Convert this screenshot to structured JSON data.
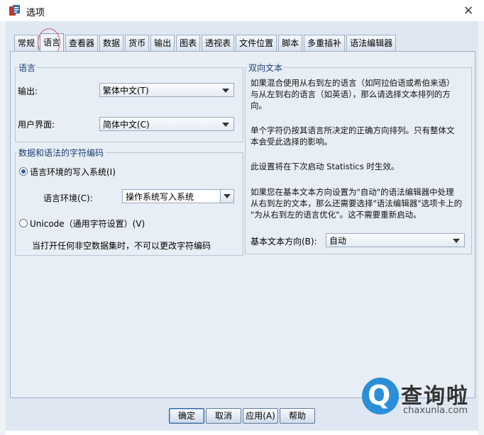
{
  "window": {
    "title": "选项",
    "close_glyph": "×",
    "icon": "spss-app-icon"
  },
  "tabs": [
    "常规",
    "语言",
    "查看器",
    "数据",
    "货币",
    "输出",
    "图表",
    "透视表",
    "文件位置",
    "脚本",
    "多重插补",
    "语法编辑器"
  ],
  "active_tab": "语言",
  "language_group": {
    "legend": "语言",
    "output_label": "输出:",
    "output_value": "繁体中文(T)",
    "ui_label": "用户界面:",
    "ui_value": "简体中文(C)"
  },
  "encoding_group": {
    "legend": "数据和语法的字符编码",
    "locale_radio_label": "语言环境的写入系统(I)",
    "locale_label": "语言环境(C):",
    "locale_value": "操作系统写入系统",
    "unicode_radio_label": "Unicode（通用字符设置）(V)",
    "note": "当打开任何非空数据集时，不可以更改字符编码"
  },
  "bidi_group": {
    "legend": "双向文本",
    "para1_line1": "如果混合使用从右到左的语言（如阿拉伯语或希伯来语）",
    "para1_line2": "与从左到右的语言（如英语），那么请选择文本排列的方",
    "para1_line3": "向。",
    "para2_line1": "单个字符仍按其语言所决定的正确方向排列。只有整体文",
    "para2_line2": "本会受此选择的影响。",
    "para3": "此设置将在下次启动 Statistics 时生效。",
    "para4_line1": "如果您在基本文本方向设置为\"自动\"的语法编辑器中处理",
    "para4_line2": "从右到左的文本，那么还需要选择\"语法编辑器\"选项卡上的",
    "para4_line3": "\"为从右到左的语言优化\"。这不需要重新启动。",
    "direction_label": "基本文本方向(B):",
    "direction_value": "自动"
  },
  "buttons": {
    "ok": "确定",
    "cancel": "取消",
    "apply": "应用(A)",
    "help": "帮助"
  },
  "watermark": {
    "text": "查询啦",
    "url": "chaxunla.com",
    "letter": "Q"
  },
  "colors": {
    "accent": "#2a5fa8",
    "highlight_ring": "#e0556a",
    "watermark_blue": "#2a8fd8"
  }
}
